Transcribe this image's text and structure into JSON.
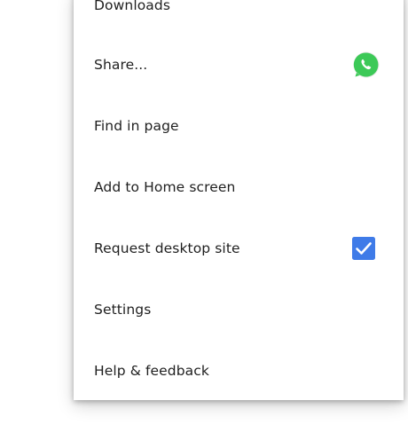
{
  "menu": {
    "items": [
      {
        "label": "Downloads"
      },
      {
        "label": "Share...",
        "trailing_icon": "whatsapp-icon"
      },
      {
        "label": "Find in page"
      },
      {
        "label": "Add to Home screen"
      },
      {
        "label": "Request desktop site",
        "checked": true
      },
      {
        "label": "Settings"
      },
      {
        "label": "Help & feedback"
      }
    ]
  },
  "colors": {
    "checkbox": "#3f7be8",
    "whatsapp": "#3cc957",
    "text": "#1f1f1f"
  }
}
